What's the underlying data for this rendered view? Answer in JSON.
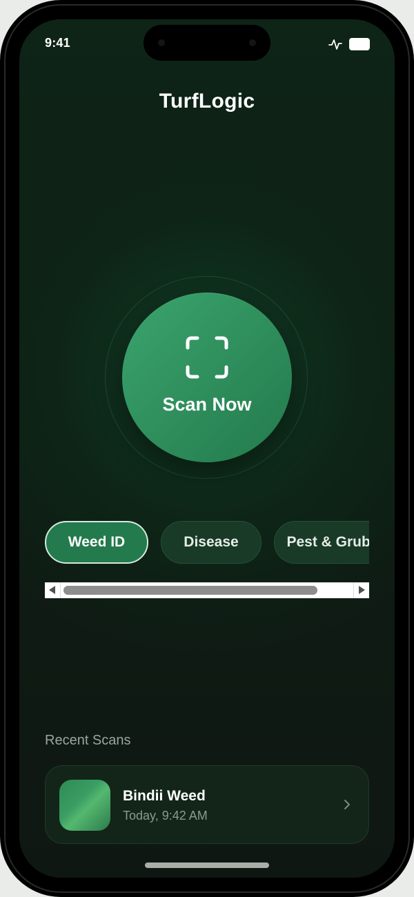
{
  "status_bar": {
    "time": "9:41",
    "icons": [
      "activity-icon",
      "battery-icon"
    ]
  },
  "app": {
    "title": "TurfLogic"
  },
  "scan": {
    "label": "Scan Now",
    "icon": "scan-frame-icon"
  },
  "categories": {
    "items": [
      {
        "label": "Weed ID",
        "active": true
      },
      {
        "label": "Disease",
        "active": false
      },
      {
        "label": "Pest & Grubs",
        "active": false
      }
    ]
  },
  "recent": {
    "section_title": "Recent Scans",
    "items": [
      {
        "title": "Bindii Weed",
        "subtitle": "Today, 9:42 AM",
        "icon": "chevron-right-icon"
      }
    ]
  },
  "colors": {
    "background": "#0f1d15",
    "accent": "#2f8f5d",
    "chip_inactive": "#183a27",
    "text_primary": "#ffffff",
    "text_secondary": "#8a9a90"
  }
}
